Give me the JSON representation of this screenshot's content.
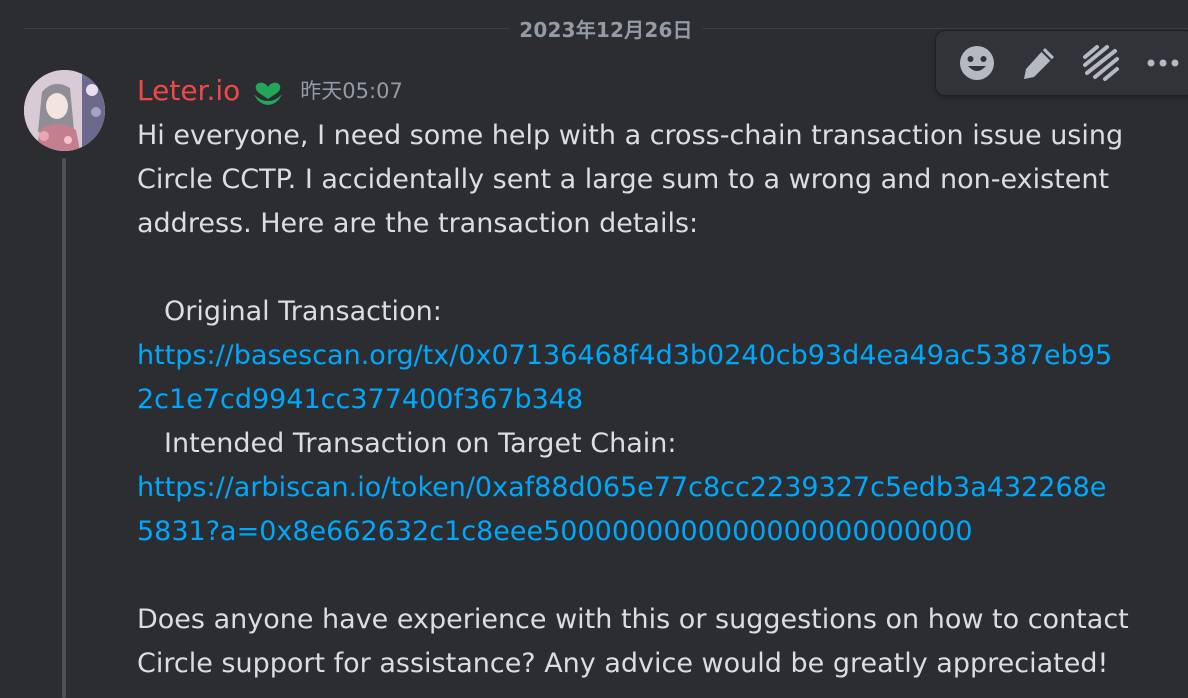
{
  "date_divider": "2023年12月26日",
  "author": {
    "username": "Leter.io",
    "timestamp": "昨天05:07"
  },
  "toolbar": {
    "icons": [
      "emoji-icon",
      "pencil-icon",
      "thread-icon",
      "more-icon"
    ]
  },
  "message": {
    "p1": [
      "Hi everyone, I need some help with a cross-chain transaction issue using",
      "Circle CCTP. I accidentally sent a large sum to a wrong and non-existent",
      "address. Here are the transaction details:"
    ],
    "original_label": "Original Transaction:",
    "original_link": [
      "https://basescan.org/tx/0x07136468f4d3b0240cb93d4ea49ac5387eb95",
      "2c1e7cd9941cc377400f367b348"
    ],
    "intended_label": "Intended Transaction on Target Chain:",
    "intended_link": [
      "https://arbiscan.io/token/0xaf88d065e77c8cc2239327c5edb3a432268e",
      "5831?a=0x8e662632c1c8eee5000000000000000000000000"
    ],
    "p2": [
      "Does anyone have experience with this or suggestions on how to contact",
      "Circle support for assistance? Any advice would be greatly appreciated!"
    ]
  },
  "colors": {
    "background": "#2b2d31",
    "username": "#f04747",
    "link": "#00a8fc",
    "role_icon": "#23a55a"
  }
}
